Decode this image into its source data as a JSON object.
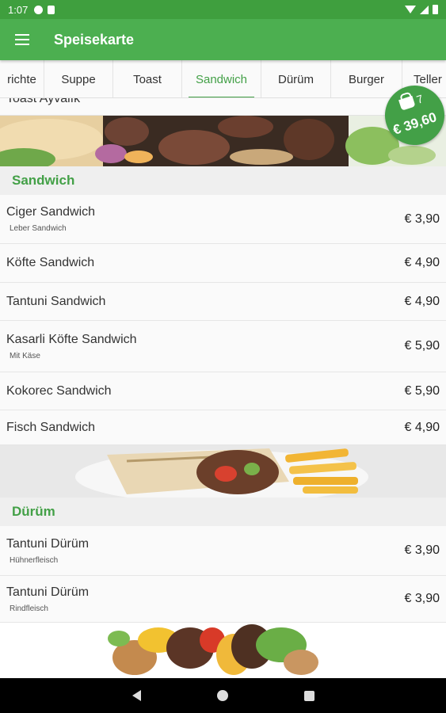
{
  "status_bar": {
    "time": "1:07"
  },
  "app_bar": {
    "title": "Speisekarte",
    "menu_icon": "hamburger-menu-icon"
  },
  "tabs": [
    {
      "label": "richte",
      "active": false
    },
    {
      "label": "Suppe",
      "active": false
    },
    {
      "label": "Toast",
      "active": false
    },
    {
      "label": "Sandwich",
      "active": true
    },
    {
      "label": "Dürüm",
      "active": false
    },
    {
      "label": "Burger",
      "active": false
    },
    {
      "label": "Teller",
      "active": false
    }
  ],
  "partial_item": {
    "name": "Toast Ayvalık"
  },
  "cart": {
    "count": "7",
    "total": "€ 39,60",
    "icon": "shopping-basket-icon"
  },
  "sections": [
    {
      "title": "Sandwich",
      "items": [
        {
          "name": "Ciger Sandwich",
          "sub": "Leber Sandwich",
          "price": "€ 3,90"
        },
        {
          "name": "Köfte Sandwich",
          "sub": "",
          "price": "€ 4,90"
        },
        {
          "name": "Tantuni Sandwich",
          "sub": "",
          "price": "€ 4,90"
        },
        {
          "name": "Kasarli Köfte Sandwich",
          "sub": "Mit Käse",
          "price": "€ 5,90"
        },
        {
          "name": "Kokorec Sandwich",
          "sub": "",
          "price": "€ 5,90"
        },
        {
          "name": "Fisch Sandwich",
          "sub": "",
          "price": "€ 4,90"
        }
      ]
    },
    {
      "title": "Dürüm",
      "items": [
        {
          "name": "Tantuni Dürüm",
          "sub": "Hühnerfleisch",
          "price": "€ 3,90"
        },
        {
          "name": "Tantuni Dürüm",
          "sub": "Rindfleisch",
          "price": "€ 3,90"
        }
      ]
    }
  ],
  "colors": {
    "primary": "#4caf50",
    "primary_dark": "#3f9f3e",
    "accent_text": "#43a047"
  }
}
